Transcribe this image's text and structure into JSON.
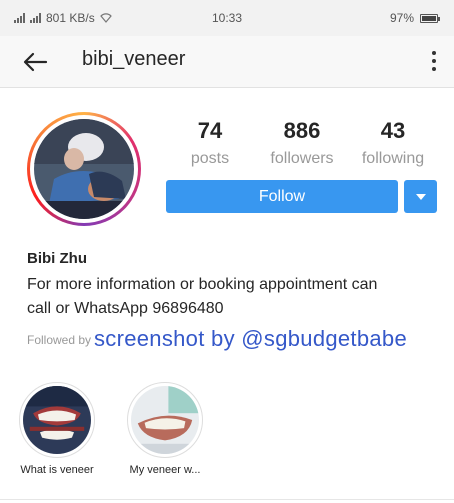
{
  "status_bar": {
    "network": "801 KB/s",
    "time": "10:33",
    "battery_text": "97%",
    "battery_level": 0.97,
    "icons": [
      "signal-icon",
      "wifi-icon",
      "battery-icon"
    ]
  },
  "header": {
    "username": "bibi_veneer",
    "back_icon": "arrow-left-icon",
    "menu_icon": "more-vertical-icon"
  },
  "profile": {
    "stats": [
      {
        "value": "74",
        "label": "posts"
      },
      {
        "value": "886",
        "label": "followers"
      },
      {
        "value": "43",
        "label": "following"
      }
    ],
    "follow_label": "Follow",
    "full_name": "Bibi Zhu",
    "bio_line1": "For more information or booking appointment can",
    "bio_line2": "call or WhatsApp 96896480",
    "followed_by": "Followed by",
    "watermark": "screenshot by @sgbudgetbabe"
  },
  "highlights": [
    {
      "label": "What is veneer"
    },
    {
      "label": "My veneer w..."
    }
  ],
  "colors": {
    "accent": "#3897f0",
    "watermark": "#3558c9"
  }
}
